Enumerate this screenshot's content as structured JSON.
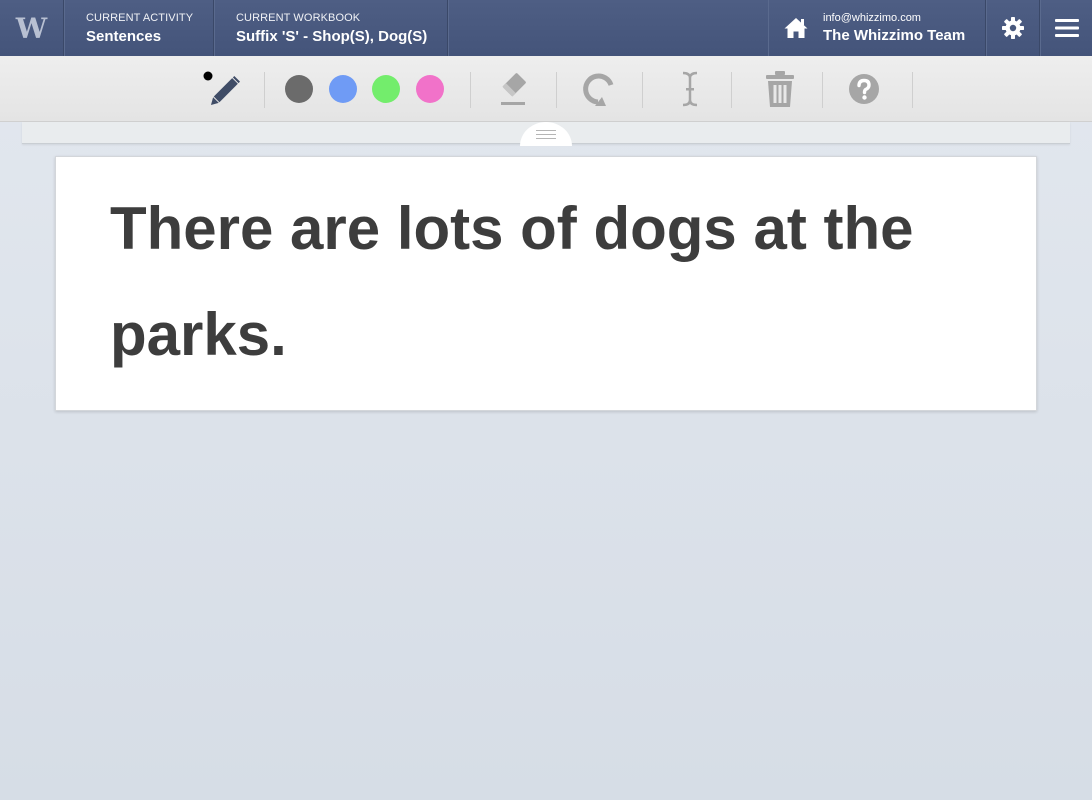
{
  "header": {
    "logo_letter": "W",
    "activity_label": "CURRENT ACTIVITY",
    "activity_value": "Sentences",
    "workbook_label": "CURRENT WORKBOOK",
    "workbook_value": "Suffix 'S' - Shop(S), Dog(S)",
    "user_email": "info@whizzimo.com",
    "user_team": "The Whizzimo Team",
    "icons": [
      "home-icon",
      "gear-icon",
      "hamburger-menu-icon"
    ]
  },
  "toolbar": {
    "tools": [
      "pencil-icon",
      "eraser-icon",
      "undo-icon",
      "text-cursor-icon",
      "trash-icon",
      "help-icon"
    ],
    "colors": [
      "#6b6b6b",
      "#6f9bf5",
      "#73ed6c",
      "#f172c9"
    ],
    "icon_color": "#a6a6a6",
    "active_color": "#3f4c66"
  },
  "content": {
    "sentence": "There are lots of dogs at the parks."
  }
}
